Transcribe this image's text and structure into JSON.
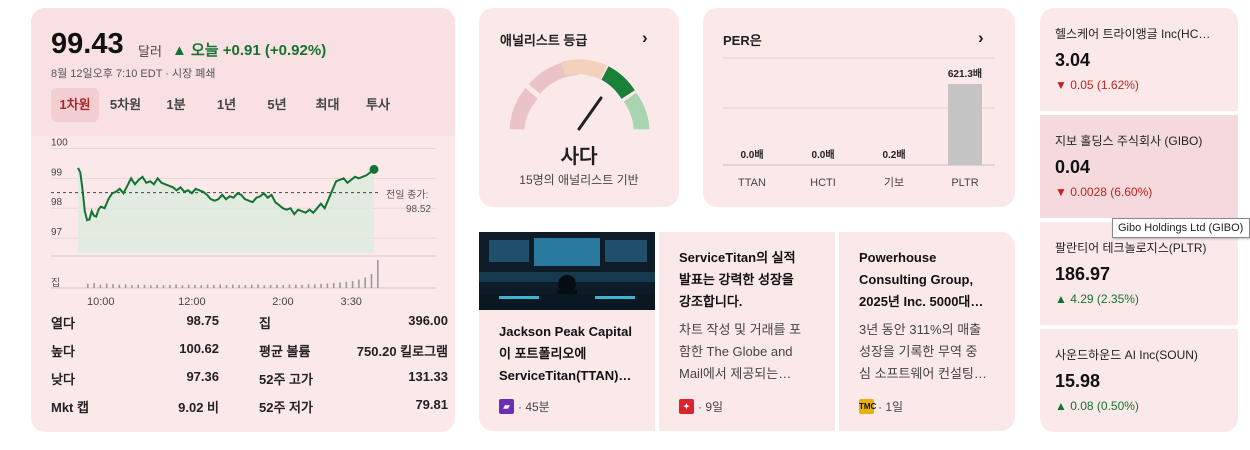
{
  "quote": {
    "price": "99.43",
    "currency": "달러",
    "change": "▲ 오늘 +0.91 (+0.92%)",
    "timestamp": "8월 12일오후 7:10 EDT · 시장 폐쇄",
    "tabs": [
      "1차원",
      "5차원",
      "1분",
      "1년",
      "5년",
      "최대",
      "투사"
    ],
    "active_tab": "1차원",
    "prev_close_label": "전일 종가:",
    "prev_close_value": "98.52",
    "stats": [
      {
        "label": "열다",
        "value": "98.75"
      },
      {
        "label": "높다",
        "value": "100.62"
      },
      {
        "label": "낮다",
        "value": "97.36"
      },
      {
        "label": "Mkt 캡",
        "value": "9.02 비"
      },
      {
        "label": "집",
        "value": "396.00"
      },
      {
        "label": "평균 볼륨",
        "value": "750.20 킬로그램"
      },
      {
        "label": "52주 고가",
        "value": "131.33"
      },
      {
        "label": "52주 저가",
        "value": "79.81"
      }
    ]
  },
  "chart_data": {
    "type": "line",
    "y_ticks": [
      "100",
      "99",
      "98",
      "97"
    ],
    "ylim": [
      96.5,
      100.25
    ],
    "x_ticks": [
      "10:00",
      "12:00",
      "2:00",
      "3:30"
    ],
    "x_tick_minutes": [
      30,
      150,
      270,
      360
    ],
    "x_range_minutes": [
      0,
      390
    ],
    "volume_label": "집",
    "reference_line": 98.52,
    "series": [
      {
        "x": [
          0,
          3,
          6,
          9,
          12,
          15,
          18,
          21,
          24,
          27,
          30,
          35,
          40,
          45,
          50,
          55,
          60,
          65,
          70,
          75,
          80,
          85,
          90,
          95,
          100,
          105,
          110,
          115,
          120,
          125,
          130,
          135,
          140,
          145,
          150,
          155,
          160,
          165,
          170,
          175,
          180,
          185,
          190,
          195,
          200,
          205,
          210,
          215,
          220,
          225,
          230,
          235,
          240,
          245,
          250,
          255,
          260,
          265,
          270,
          275,
          280,
          285,
          290,
          295,
          300,
          305,
          310,
          315,
          320,
          325,
          330,
          335,
          340,
          345,
          350,
          355,
          360,
          365,
          370,
          375,
          380,
          385,
          390
        ],
        "values": [
          99.35,
          99.2,
          98.6,
          97.9,
          97.6,
          97.62,
          97.9,
          97.75,
          97.72,
          97.95,
          98.05,
          98.0,
          98.3,
          98.5,
          98.55,
          98.65,
          98.5,
          98.75,
          99.0,
          98.8,
          98.95,
          99.05,
          98.85,
          98.9,
          98.8,
          99.0,
          98.85,
          98.8,
          98.75,
          98.7,
          98.6,
          98.7,
          98.55,
          98.6,
          98.5,
          98.65,
          98.6,
          98.55,
          98.45,
          98.3,
          98.25,
          98.3,
          98.45,
          98.3,
          98.4,
          98.35,
          98.5,
          98.45,
          98.3,
          98.25,
          98.2,
          98.35,
          98.4,
          98.5,
          98.35,
          98.45,
          98.2,
          98.1,
          98.0,
          97.95,
          98.0,
          97.8,
          97.95,
          97.9,
          97.85,
          97.95,
          97.85,
          98.0,
          98.15,
          98.0,
          98.3,
          98.6,
          98.9,
          98.95,
          99.0,
          98.85,
          98.95,
          99.05,
          99.0,
          99.05,
          99.1,
          99.2,
          99.3
        ]
      }
    ],
    "volume": [
      0.15,
      0.18,
      0.12,
      0.16,
      0.14,
      0.12,
      0.13,
      0.1,
      0.12,
      0.11,
      0.1,
      0.12,
      0.1,
      0.11,
      0.13,
      0.1,
      0.12,
      0.11,
      0.1,
      0.12,
      0.11,
      0.13,
      0.1,
      0.12,
      0.11,
      0.1,
      0.12,
      0.13,
      0.1,
      0.11,
      0.12,
      0.1,
      0.13,
      0.12,
      0.11,
      0.14,
      0.13,
      0.15,
      0.16,
      0.18,
      0.2,
      0.22,
      0.25,
      0.3,
      0.38,
      0.5,
      1.0
    ]
  },
  "analyst": {
    "title": "애널리스트 등급",
    "rating": "사다",
    "subtitle": "15명의 애널리스트 기반",
    "colors": [
      "#e9c3c6",
      "#f3d1bc",
      "#188038",
      "#a8d5b0"
    ]
  },
  "per": {
    "title": "PER은",
    "bars": [
      {
        "label": "TTAN",
        "value": 0.0,
        "display": "0.0배"
      },
      {
        "label": "HCTI",
        "value": 0.0,
        "display": "0.0배"
      },
      {
        "label": "기보",
        "value": 0.2,
        "display": "0.2배"
      },
      {
        "label": "PLTR",
        "value": 621.3,
        "display": "621.3배"
      }
    ]
  },
  "news": [
    {
      "headline_lines": [
        "Jackson Peak Capital",
        "이 포트폴리오에",
        "ServiceTitan(TTAN)…"
      ],
      "source_ago": "· 45분",
      "logo_color": "#6b2fb3"
    },
    {
      "headline_lines": [
        "ServiceTitan의 실적",
        "발표는 강력한 성장을",
        "강조합니다."
      ],
      "body_lines": [
        "차트 작성 및 거래를 포",
        "함한 The Globe and",
        "Mail에서 제공되는…"
      ],
      "source_ago": "· 9일",
      "logo_color": "#d9232d"
    },
    {
      "headline_lines": [
        "Powerhouse",
        "Consulting Group,",
        "2025년 Inc. 5000대…"
      ],
      "body_lines": [
        "3년 동안 311%의 매출",
        "성장을 기록한 무역 중",
        "심 소프트웨어 컨설팅…"
      ],
      "source_ago": "· 1일",
      "logo_text": "TMC",
      "logo_color": "#e8b10a"
    }
  ],
  "sidebar": [
    {
      "name": "헬스케어 트라이앵글 Inc(HC…",
      "price": "3.04",
      "change": "▼ 0.05 (1.62%)",
      "direction": "down"
    },
    {
      "name": "지보 홀딩스 주식회사 (GIBO)",
      "price": "0.04",
      "change": "▼ 0.0028 (6.60%)",
      "direction": "down"
    },
    {
      "name": "팔란티어 테크놀로지스(PLTR)",
      "price": "186.97",
      "change": "▲ 4.29 (2.35%)",
      "direction": "up"
    },
    {
      "name": "사운드하운드 AI Inc(SOUN)",
      "price": "15.98",
      "change": "▲ 0.08 (0.50%)",
      "direction": "up"
    }
  ],
  "tooltip": "Gibo Holdings Ltd (GIBO)"
}
